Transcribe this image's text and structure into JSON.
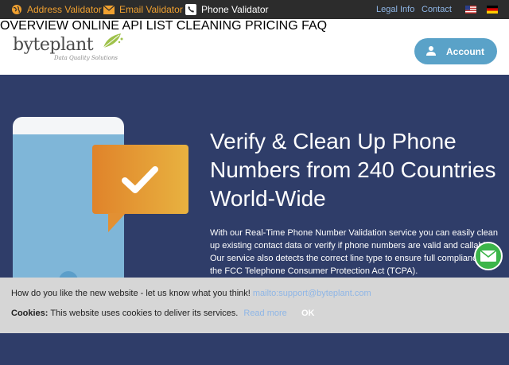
{
  "topbar": {
    "address_validator": "Address Validator",
    "email_validator": "Email Validator",
    "phone_validator": "Phone Validator",
    "legal_info": "Legal Info",
    "contact": "Contact"
  },
  "header": {
    "brand": "byteplant",
    "tagline": "Data Quality Solutions",
    "nav": [
      "OVERVIEW",
      "ONLINE API",
      "LIST CLEANING",
      "PRICING",
      "FAQ"
    ],
    "account": "Account"
  },
  "hero": {
    "title": "Verify & Clean Up Phone Numbers from 240 Countries World-Wide",
    "text": "With our Real-Time Phone Number Validation service you can easily clean up existing contact data or verify if phone numbers are valid and callable. Our service also detects the correct line type to ensure full compliance with the FCC Telephone Consumer Protection Act (TCPA)."
  },
  "cookie": {
    "feedback": "How do you like the new website - let us know what you think!",
    "mailto": "mailto:support@byteplant.com",
    "cookies_label": "Cookies:",
    "cookies_text": "This website uses cookies to deliver its services.",
    "read_more": "Read more",
    "ok": "OK"
  },
  "colors": {
    "hero_bg": "#2f3d69",
    "accent_orange": "#e07b1f",
    "account_blue": "#5aa2c8",
    "mail_green": "#3cb54a"
  }
}
